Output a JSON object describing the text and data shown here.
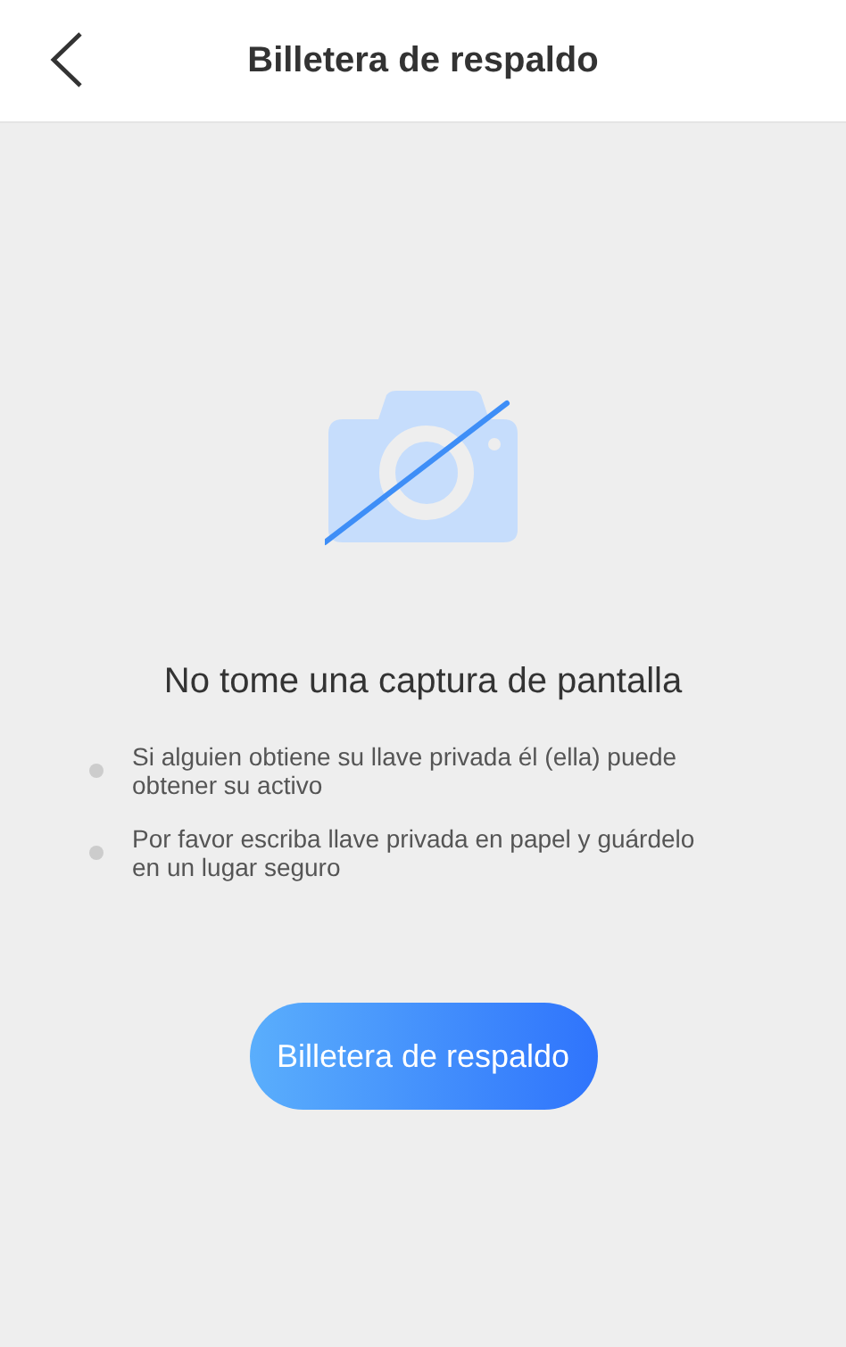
{
  "header": {
    "title": "Billetera de respaldo"
  },
  "warning": {
    "heading": "No tome una captura de pantalla",
    "tips": [
      "Si alguien obtiene su llave privada él (ella) puede obtener su activo",
      "Por favor escriba llave privada en papel y guárdelo en un lugar seguro"
    ]
  },
  "button": {
    "label": "Billetera de respaldo"
  }
}
